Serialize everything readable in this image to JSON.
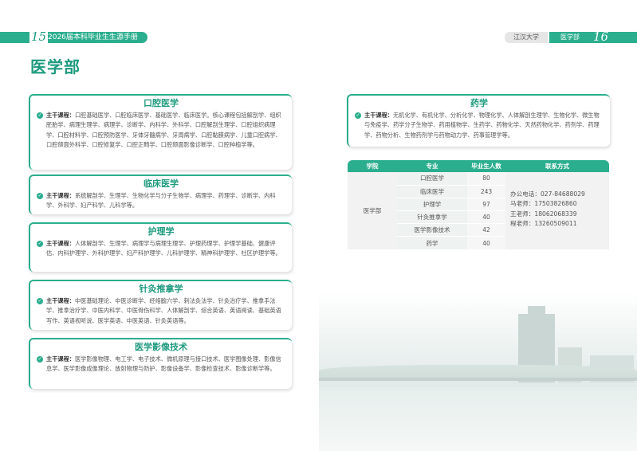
{
  "header": {
    "left_page_num": "15",
    "left_title": "2026届本科毕业生生源手册",
    "university": "江汉大学",
    "department": "医学部",
    "right_page_num": "16"
  },
  "page_title": "医学部",
  "courses_label": "主干课程：",
  "majors": [
    {
      "name": "口腔医学",
      "courses": "口腔基础医学、口腔临床医学、基础医学、临床医学。核心课程包括解剖学、组织胚胎学、病理生理学、病理学、诊断学、内科学、外科学、口腔解剖生理学、口腔组织病理学、口腔材料学、口腔预防医学、牙体牙髓病学、牙周病学、口腔黏膜病学、儿童口腔病学、口腔颌面外科学、口腔修复学、口腔正畸学、口腔颌面影像诊断学、口腔种植学等。"
    },
    {
      "name": "临床医学",
      "courses": "系统解剖学、生理学、生物化学与分子生物学、病理学、药理学、诊断学、内科学、外科学、妇产科学、儿科学等。"
    },
    {
      "name": "护理学",
      "courses": "人体解剖学、生理学、病理学与病理生理学、护理药理学、护理学基础、健康评估、内科护理学、外科护理学、妇产科护理学、儿科护理学、精神科护理学、社区护理学等。"
    },
    {
      "name": "针灸推拿学",
      "courses": "中医基础理论、中医诊断学、经络腧穴学、刺法灸法学、针灸治疗学、推拿手法学、推拿治疗学、中医内科学、中医骨伤科学、人体解剖学、综合英语、英语阅读、基础英语写作、英语视听说、医学英语、中医英语、针灸英语等。"
    },
    {
      "name": "医学影像技术",
      "courses": "医学影像物理、电工学、电子技术、微机原理与接口技术、医学图像处理、影像信息学、医学影像成像理论、放射物理与防护、影像设备学、影像检查技术、影像诊断学等。"
    },
    {
      "name": "药学",
      "courses": "无机化学、有机化学、分析化学、物理化学、人体解剖生理学、生物化学、微生物与免疫学、药学分子生物学、药用植物学、生药学、药物化学、天然药物化学、药剂学、药理学、药物分析、生物药剂学与药物动力学、药事管理学等。"
    }
  ],
  "table": {
    "headers": [
      "学院",
      "专业",
      "毕业生人数",
      "联系方式"
    ],
    "college": "医学部",
    "rows": [
      {
        "major": "口腔医学",
        "count": "80"
      },
      {
        "major": "临床医学",
        "count": "243"
      },
      {
        "major": "护理学",
        "count": "97"
      },
      {
        "major": "针灸推拿学",
        "count": "40"
      },
      {
        "major": "医学影像技术",
        "count": "42"
      },
      {
        "major": "药学",
        "count": "40"
      }
    ],
    "contacts": [
      "办公电话：027-84688029",
      "马老师：17503826860",
      "王老师：18062068339",
      "程老师：13260509011"
    ]
  }
}
